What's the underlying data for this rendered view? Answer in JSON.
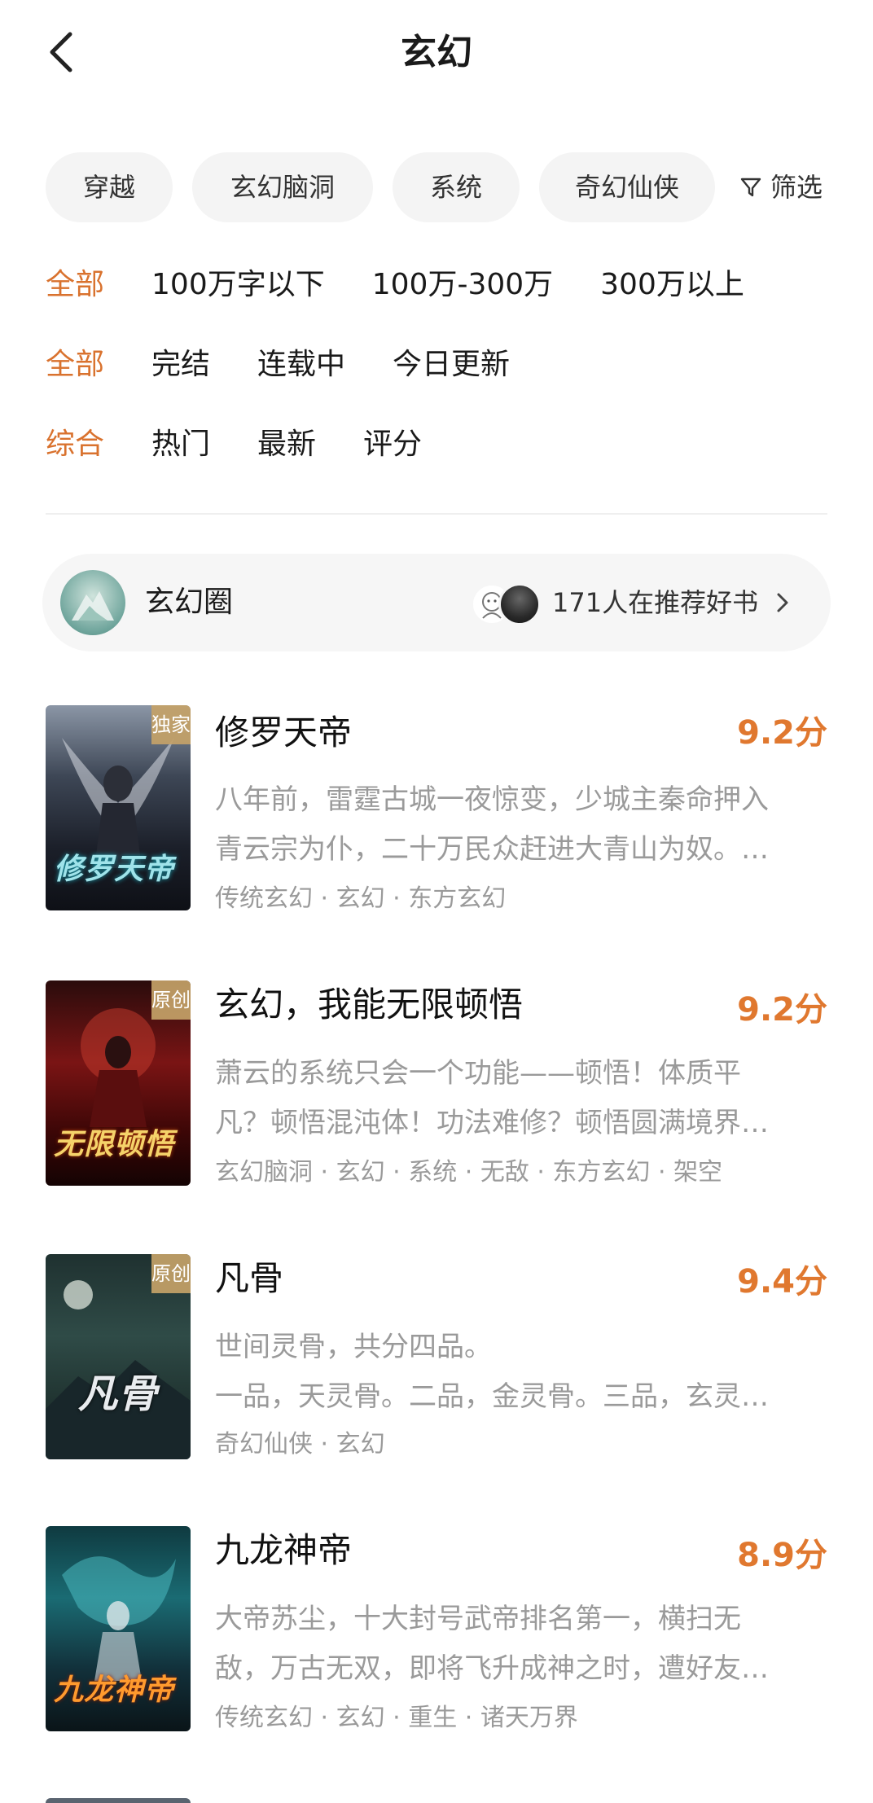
{
  "header": {
    "title": "玄幻",
    "back_icon": "chevron-left-icon"
  },
  "chips": [
    "穿越",
    "玄幻脑洞",
    "系统",
    "奇幻仙侠"
  ],
  "filter": {
    "label": "筛选",
    "icon": "funnel-icon"
  },
  "filter_rows": [
    {
      "items": [
        "全部",
        "100万字以下",
        "100万-300万",
        "300万以上"
      ],
      "active": 0
    },
    {
      "items": [
        "全部",
        "完结",
        "连载中",
        "今日更新"
      ],
      "active": 0
    },
    {
      "items": [
        "综合",
        "热门",
        "最新",
        "评分"
      ],
      "active": 0
    }
  ],
  "circle": {
    "name": "玄幻圈",
    "recommend_text": "171人在推荐好书"
  },
  "books": [
    {
      "badge": "独家",
      "cover_title": "修罗天帝",
      "title": "修罗天帝",
      "score": "9.2分",
      "desc_line1": "八年前，雷霆古城一夜惊变，少城主秦命押入",
      "desc_line2": "青云宗为仆，二十万民众赶进大青山为奴。…",
      "tags": "传统玄幻 · 玄幻 · 东方玄幻"
    },
    {
      "badge": "原创",
      "cover_title": "无限顿悟",
      "title": "玄幻，我能无限顿悟",
      "score": "9.2分",
      "desc_line1": "萧云的系统只会一个功能——顿悟！体质平",
      "desc_line2": "凡？顿悟混沌体！功法难修？顿悟圆满境界…",
      "tags": "玄幻脑洞 · 玄幻 · 系统 · 无敌 · 东方玄幻 · 架空"
    },
    {
      "badge": "原创",
      "cover_title": "凡骨",
      "title": "凡骨",
      "score": "9.4分",
      "desc_line1": "世间灵骨，共分四品。",
      "desc_line2": "一品，天灵骨。二品，金灵骨。三品，玄灵…",
      "tags": "奇幻仙侠 · 玄幻"
    },
    {
      "badge": "",
      "cover_title": "九龙神帝",
      "title": "九龙神帝",
      "score": "8.9分",
      "desc_line1": "大帝苏尘，十大封号武帝排名第一，横扫无",
      "desc_line2": "敌，万古无双，即将飞升成神之时，遭好友…",
      "tags": "传统玄幻 · 玄幻 · 重生 · 诸天万界"
    }
  ]
}
